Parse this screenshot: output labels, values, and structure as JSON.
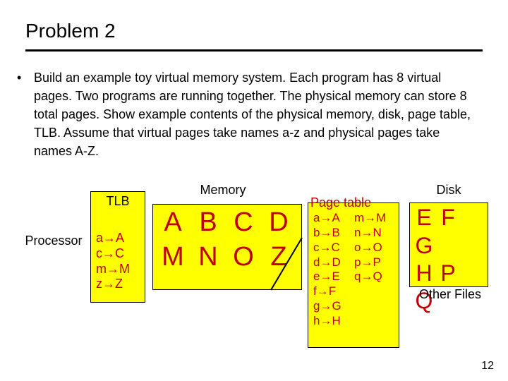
{
  "title": "Problem 2",
  "bullet": "Build an example toy virtual memory system.  Each program has 8 virtual pages.  Two programs are running together.  The physical memory can store 8 total pages.  Show example contents of the physical memory, disk, page table, TLB.  Assume that virtual pages take names a-z and physical pages take names A-Z.",
  "processor_label": "Processor",
  "tlb": {
    "label": "TLB",
    "entries": [
      "a→A",
      "c→C",
      "m→M",
      "z→Z"
    ]
  },
  "memory": {
    "label": "Memory",
    "cells": [
      "A",
      "B",
      "C",
      "D",
      "M",
      "N",
      "O",
      "Z"
    ]
  },
  "page_table": {
    "label": "Page table",
    "left": [
      "a→A",
      "b→B",
      "c→C",
      "d→D",
      "e→E",
      "f→F",
      "g→G",
      "h→H"
    ],
    "right": [
      "m→M",
      "n→N",
      "o→O",
      "p→P",
      "q→Q"
    ]
  },
  "disk": {
    "label": "Disk",
    "cells": [
      "E",
      "F",
      "G",
      "H",
      "P",
      "Q"
    ],
    "other": "Other Files"
  },
  "page_number": "12"
}
